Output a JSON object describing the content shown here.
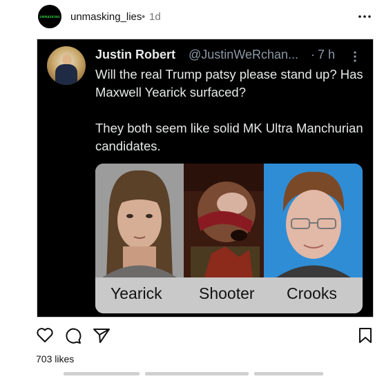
{
  "header": {
    "avatar_logo_text": "UNMASKING",
    "username": "unmasking_lies",
    "separator": "•",
    "time": "1d",
    "more_icon": "more-horizontal-icon"
  },
  "tweet": {
    "display_name": "Justin Robert",
    "handle": "@JustinWeRchan...",
    "separator": "·",
    "time": "7 h",
    "more_icon": "more-vertical-icon",
    "text_line1": "Will the real Trump patsy please stand up? Has Maxwell Yearick surfaced?",
    "text_line2": "They both seem like solid MK Ultra Manchurian candidates.",
    "captions": [
      "Yearick",
      "Shooter",
      "Crooks"
    ]
  },
  "actions": {
    "like_icon": "heart-icon",
    "comment_icon": "comment-icon",
    "share_icon": "send-icon",
    "save_icon": "bookmark-icon"
  },
  "likes": "703 likes"
}
